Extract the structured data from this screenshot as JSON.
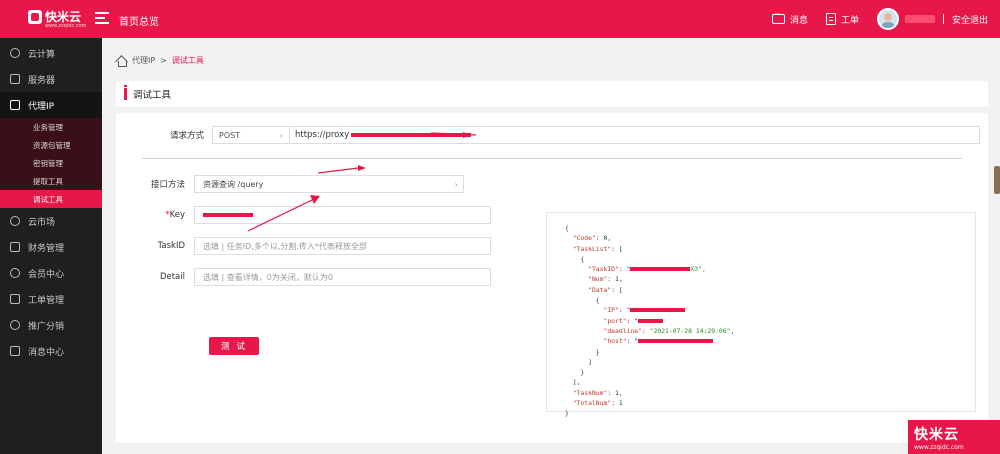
{
  "app": {
    "logo_text": "快米云",
    "logo_sub": "www.zzqidc.com",
    "home_title": "首页总览"
  },
  "topbar": {
    "messages_label": "消息",
    "tickets_label": "工单",
    "logout_label": "安全退出"
  },
  "sidebar": {
    "items": [
      {
        "label": "云计算"
      },
      {
        "label": "服务器"
      },
      {
        "label": "代理IP"
      },
      {
        "label": "云市场"
      },
      {
        "label": "财务管理"
      },
      {
        "label": "会员中心"
      },
      {
        "label": "工单管理"
      },
      {
        "label": "推广分销"
      },
      {
        "label": "消息中心"
      }
    ],
    "subitems": [
      {
        "label": "业务管理"
      },
      {
        "label": "资源包管理"
      },
      {
        "label": "密钥管理"
      },
      {
        "label": "提取工具"
      },
      {
        "label": "调试工具"
      }
    ]
  },
  "breadcrumb": {
    "parent": "代理IP",
    "separator": ">",
    "current": "调试工具"
  },
  "page": {
    "title": "调试工具"
  },
  "form": {
    "request_label": "请求方式",
    "method": "POST",
    "url_prefix": "https://proxy",
    "api_label": "接口方法",
    "api_value": "资源查询  /query",
    "key_label": "Key",
    "key_value": "",
    "taskid_label": "TaskID",
    "taskid_placeholder": "选填 | 任务ID,多个以,分割,传入*代表释放全部",
    "detail_label": "Detail",
    "detail_placeholder": "选填 | 查看详情，0为关闭，默认为0",
    "test_button": "测 试"
  },
  "result": {
    "lines": [
      "{",
      "  \"Code\": 0,",
      "  \"TaskList\": [",
      "    {",
      "      \"TaskID\": \"",
      "      \"Num\": 1,",
      "      \"Data\": [",
      "        {",
      "          \"IP\": \"",
      "          \"port\": \"",
      "          \"deadline\": \"2021-07-28 14:29:06\",",
      "          \"host\": \"",
      "        }",
      "      ]",
      "    }",
      "  ],",
      "  \"TaskNum\": 1,",
      "  \"TotalNum\": 1",
      "}"
    ],
    "taskid_suffix": "X3\","
  },
  "brand": {
    "name": "快米云",
    "url": "www.zzqidc.com"
  }
}
